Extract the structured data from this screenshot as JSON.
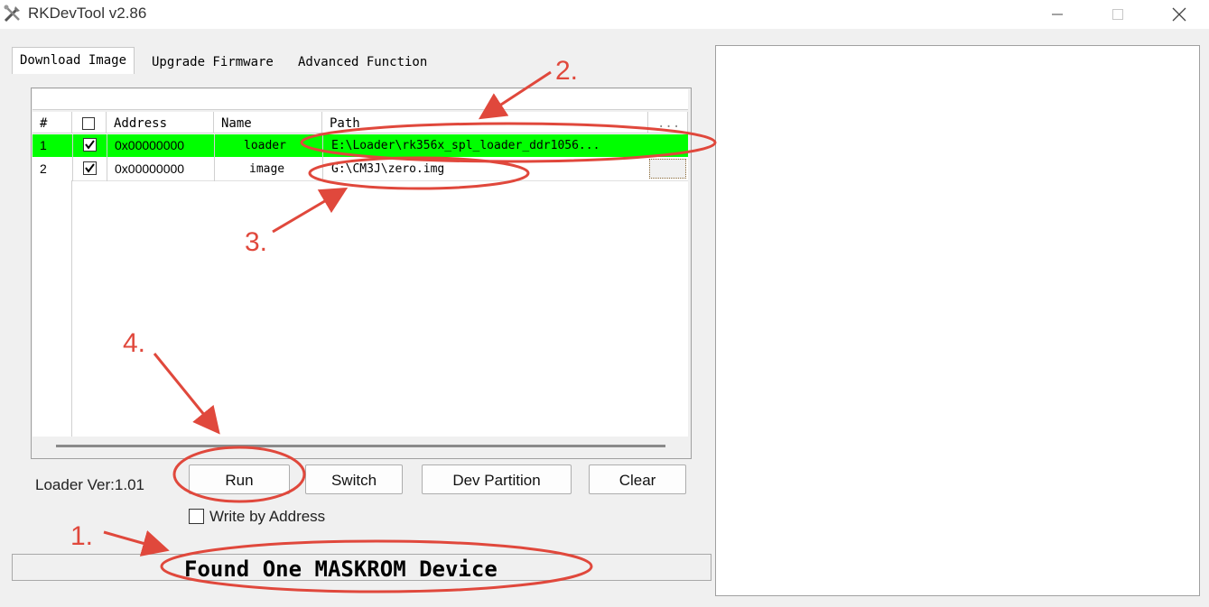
{
  "window": {
    "title": "RKDevTool v2.86"
  },
  "tabs": [
    {
      "label": "Download Image",
      "active": true
    },
    {
      "label": "Upgrade Firmware",
      "active": false
    },
    {
      "label": "Advanced Function",
      "active": false
    }
  ],
  "table": {
    "headers": {
      "num": "#",
      "address": "Address",
      "name": "Name",
      "path": "Path",
      "more": "..."
    },
    "rows": [
      {
        "num": "1",
        "checked": true,
        "address": "0x00000000",
        "name": "loader",
        "path": "E:\\Loader\\rk356x_spl_loader_ddr1056...",
        "highlight_color": "#00ff00"
      },
      {
        "num": "2",
        "checked": true,
        "address": "0x00000000",
        "name": "image",
        "path": "G:\\CM3J\\zero.img"
      }
    ]
  },
  "controls": {
    "loader_ver": "Loader Ver:1.01",
    "run": "Run",
    "switch": "Switch",
    "dev_partition": "Dev Partition",
    "clear": "Clear",
    "write_by_address": "Write by Address"
  },
  "status": {
    "text": "Found One MASKROM Device"
  },
  "annotations": {
    "step1": "1.",
    "step2": "2.",
    "step3": "3.",
    "step4": "4.",
    "color": "#e0483c"
  }
}
